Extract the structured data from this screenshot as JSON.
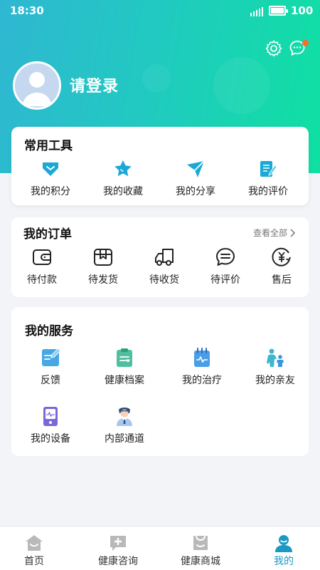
{
  "status_bar": {
    "time": "18:30",
    "battery": "100"
  },
  "header": {
    "login_label": "请登录"
  },
  "tools": {
    "title": "常用工具",
    "items": [
      {
        "label": "我的积分",
        "icon": "points-icon"
      },
      {
        "label": "我的收藏",
        "icon": "star-icon"
      },
      {
        "label": "我的分享",
        "icon": "share-plane-icon"
      },
      {
        "label": "我的评价",
        "icon": "review-edit-icon"
      }
    ]
  },
  "orders": {
    "title": "我的订单",
    "view_all": "查看全部",
    "items": [
      {
        "label": "待付款",
        "icon": "wallet-icon"
      },
      {
        "label": "待发货",
        "icon": "package-icon"
      },
      {
        "label": "待收货",
        "icon": "truck-icon"
      },
      {
        "label": "待评价",
        "icon": "comment-icon"
      },
      {
        "label": "售后",
        "icon": "refund-yen-icon"
      }
    ]
  },
  "services": {
    "title": "我的服务",
    "items": [
      {
        "label": "反馈",
        "icon": "feedback-icon"
      },
      {
        "label": "健康档案",
        "icon": "health-record-icon"
      },
      {
        "label": "我的治疗",
        "icon": "treatment-icon"
      },
      {
        "label": "我的亲友",
        "icon": "family-icon"
      },
      {
        "label": "我的设备",
        "icon": "device-icon"
      },
      {
        "label": "内部通道",
        "icon": "staff-icon"
      }
    ]
  },
  "tabbar": {
    "tabs": [
      {
        "label": "首页",
        "icon": "home-icon"
      },
      {
        "label": "健康咨询",
        "icon": "consult-icon"
      },
      {
        "label": "健康商城",
        "icon": "shop-icon"
      },
      {
        "label": "我的",
        "icon": "profile-icon",
        "active": true
      }
    ]
  },
  "colors": {
    "accent": "#1a99c4",
    "gradient_start": "#2fb7d2",
    "gradient_end": "#0fe0a2",
    "notify": "#ff6a2b"
  }
}
